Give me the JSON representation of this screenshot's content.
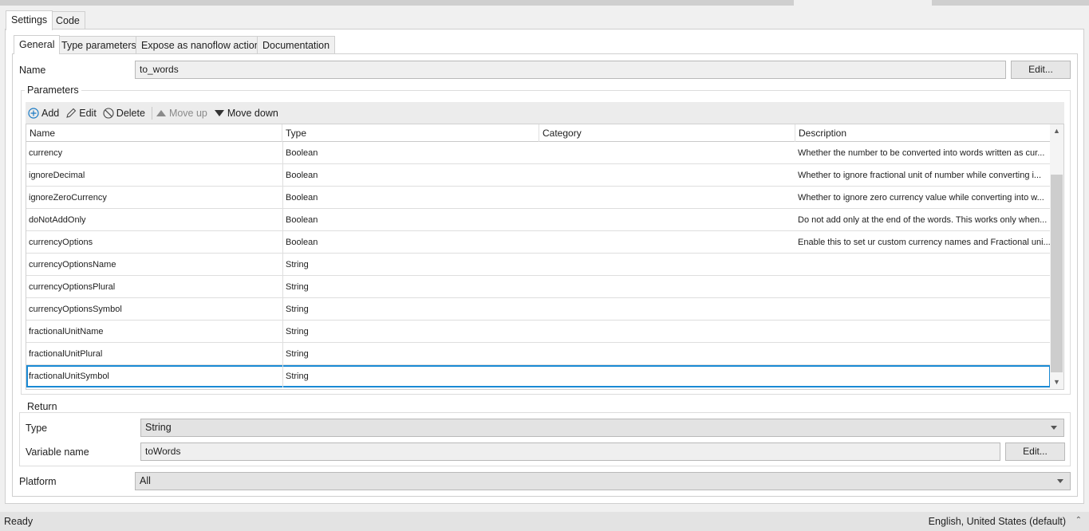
{
  "tabs": {
    "settings": "Settings",
    "code": "Code"
  },
  "subtabs": {
    "general": "General",
    "type_parameters": "Type parameters",
    "expose": "Expose as nanoflow action",
    "documentation": "Documentation"
  },
  "name": {
    "label": "Name",
    "value": "to_words",
    "edit_label": "Edit..."
  },
  "parameters": {
    "title": "Parameters",
    "toolbar": {
      "add": "Add",
      "edit": "Edit",
      "delete": "Delete",
      "move_up": "Move up",
      "move_down": "Move down"
    },
    "columns": {
      "name": "Name",
      "type": "Type",
      "category": "Category",
      "description": "Description"
    },
    "rows": [
      {
        "name": "currency",
        "type": "Boolean",
        "category": "",
        "description": "Whether the number to be converted into words written as cur..."
      },
      {
        "name": "ignoreDecimal",
        "type": "Boolean",
        "category": "",
        "description": "Whether to ignore fractional unit of number while converting i..."
      },
      {
        "name": "ignoreZeroCurrency",
        "type": "Boolean",
        "category": "",
        "description": "Whether to ignore zero currency value while converting into w..."
      },
      {
        "name": "doNotAddOnly",
        "type": "Boolean",
        "category": "",
        "description": "Do not add only at the end of the words. This works only when..."
      },
      {
        "name": "currencyOptions",
        "type": "Boolean",
        "category": "",
        "description": "Enable this to set ur custom currency names and Fractional uni..."
      },
      {
        "name": "currencyOptionsName",
        "type": "String",
        "category": "",
        "description": ""
      },
      {
        "name": "currencyOptionsPlural",
        "type": "String",
        "category": "",
        "description": ""
      },
      {
        "name": "currencyOptionsSymbol",
        "type": "String",
        "category": "",
        "description": ""
      },
      {
        "name": "fractionalUnitName",
        "type": "String",
        "category": "",
        "description": ""
      },
      {
        "name": "fractionalUnitPlural",
        "type": "String",
        "category": "",
        "description": ""
      },
      {
        "name": "fractionalUnitSymbol",
        "type": "String",
        "category": "",
        "description": ""
      }
    ],
    "selected_row": "fractionalUnitSymbol"
  },
  "return": {
    "title": "Return",
    "type_label": "Type",
    "type_value": "String",
    "variable_label": "Variable name",
    "variable_value": "toWords",
    "edit_label": "Edit..."
  },
  "platform": {
    "label": "Platform",
    "value": "All"
  },
  "status": {
    "left": "Ready",
    "right": "English, United States (default)"
  },
  "colors": {
    "selection": "#1a8ad4",
    "panel": "#ffffff",
    "chrome": "#f0f0f0"
  }
}
